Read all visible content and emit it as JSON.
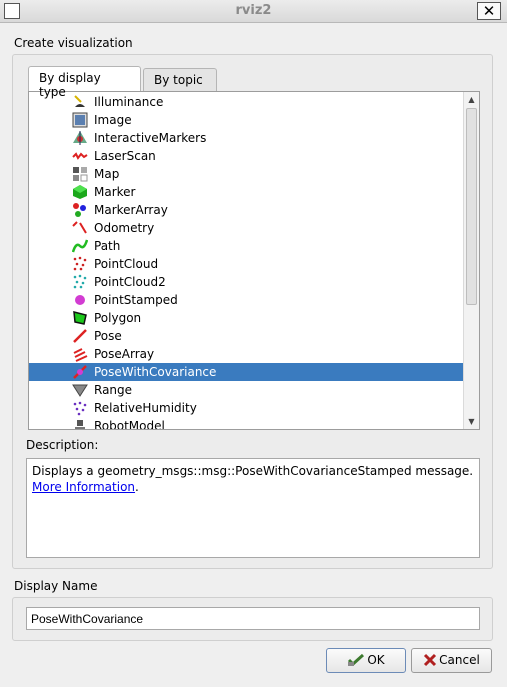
{
  "window": {
    "title": "rviz2"
  },
  "group": {
    "label": "Create visualization"
  },
  "tabs": [
    {
      "label": "By display type",
      "active": true
    },
    {
      "label": "By topic",
      "active": false
    }
  ],
  "display_types": [
    {
      "label": "Illuminance",
      "icon": "illuminance-icon",
      "selected": false
    },
    {
      "label": "Image",
      "icon": "image-icon",
      "selected": false
    },
    {
      "label": "InteractiveMarkers",
      "icon": "interactive-markers-icon",
      "selected": false
    },
    {
      "label": "LaserScan",
      "icon": "laser-scan-icon",
      "selected": false
    },
    {
      "label": "Map",
      "icon": "map-icon",
      "selected": false
    },
    {
      "label": "Marker",
      "icon": "marker-icon",
      "selected": false
    },
    {
      "label": "MarkerArray",
      "icon": "marker-array-icon",
      "selected": false
    },
    {
      "label": "Odometry",
      "icon": "odometry-icon",
      "selected": false
    },
    {
      "label": "Path",
      "icon": "path-icon",
      "selected": false
    },
    {
      "label": "PointCloud",
      "icon": "point-cloud-icon",
      "selected": false
    },
    {
      "label": "PointCloud2",
      "icon": "point-cloud2-icon",
      "selected": false
    },
    {
      "label": "PointStamped",
      "icon": "point-stamped-icon",
      "selected": false
    },
    {
      "label": "Polygon",
      "icon": "polygon-icon",
      "selected": false
    },
    {
      "label": "Pose",
      "icon": "pose-icon",
      "selected": false
    },
    {
      "label": "PoseArray",
      "icon": "pose-array-icon",
      "selected": false
    },
    {
      "label": "PoseWithCovariance",
      "icon": "pose-with-covariance-icon",
      "selected": true
    },
    {
      "label": "Range",
      "icon": "range-icon",
      "selected": false
    },
    {
      "label": "RelativeHumidity",
      "icon": "relative-humidity-icon",
      "selected": false
    },
    {
      "label": "RobotModel",
      "icon": "robot-model-icon",
      "selected": false
    }
  ],
  "description": {
    "label": "Description:",
    "text": "Displays a geometry_msgs::msg::PoseWithCovarianceStamped message.",
    "link_text": "More Information",
    "after_link": "."
  },
  "display_name": {
    "label": "Display Name",
    "value": "PoseWithCovariance"
  },
  "buttons": {
    "ok": "OK",
    "cancel": "Cancel"
  },
  "colors": {
    "selection": "#3a7bbf",
    "link": "#0000ee"
  }
}
